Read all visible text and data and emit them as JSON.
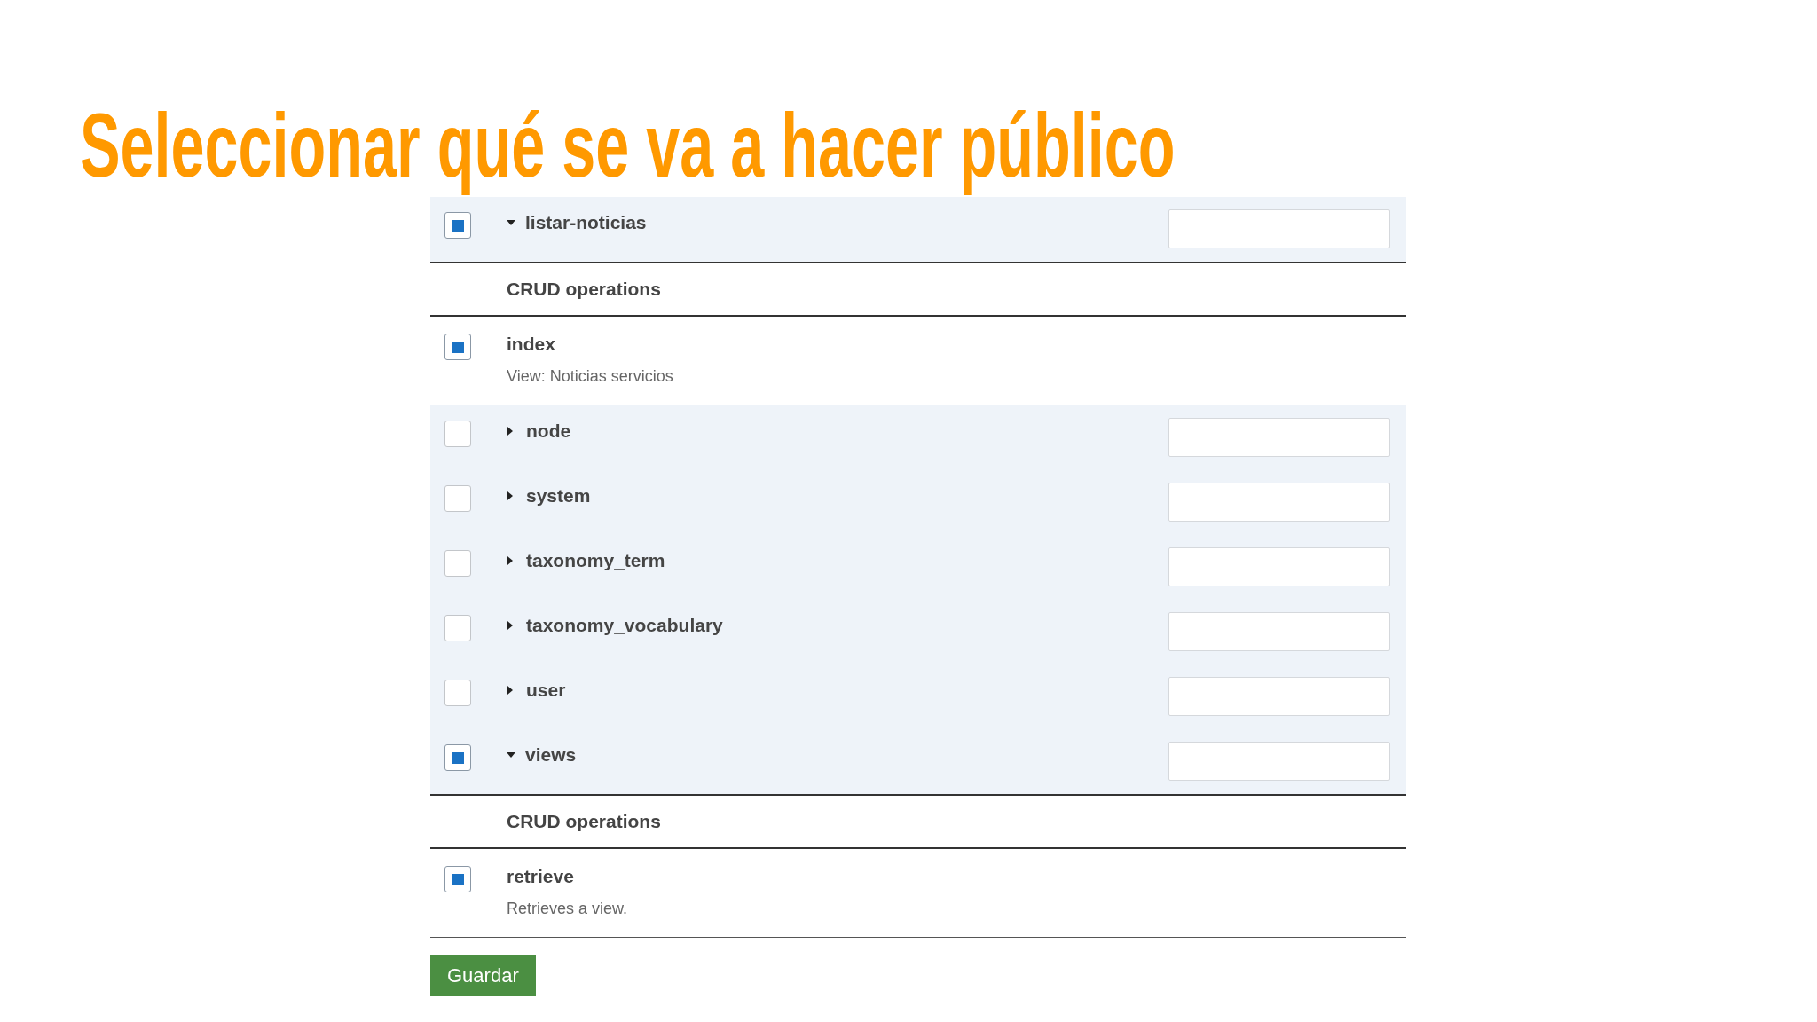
{
  "title": "Seleccionar qué se va a hacer público",
  "resources": [
    {
      "name": "listar-noticias",
      "checked": true,
      "expanded": true,
      "children": [
        {
          "heading": "CRUD operations",
          "children": [
            {
              "name": "index",
              "description": "View: Noticias servicios",
              "checked": true
            }
          ]
        }
      ]
    },
    {
      "name": "node",
      "checked": false,
      "expanded": false
    },
    {
      "name": "system",
      "checked": false,
      "expanded": false
    },
    {
      "name": "taxonomy_term",
      "checked": false,
      "expanded": false
    },
    {
      "name": "taxonomy_vocabulary",
      "checked": false,
      "expanded": false
    },
    {
      "name": "user",
      "checked": false,
      "expanded": false
    },
    {
      "name": "views",
      "checked": true,
      "expanded": true,
      "children": [
        {
          "heading": "CRUD operations",
          "children": [
            {
              "name": "retrieve",
              "description": "Retrieves a view.",
              "checked": true
            }
          ]
        }
      ]
    }
  ],
  "buttons": [
    "Guardar"
  ]
}
